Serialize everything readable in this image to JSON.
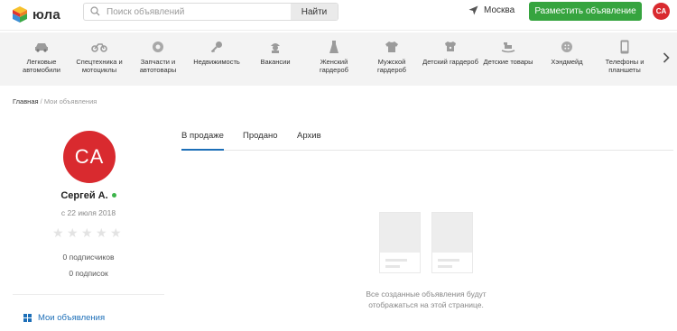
{
  "header": {
    "logo_text": "юла",
    "search_placeholder": "Поиск объявлений",
    "search_button": "Найти",
    "location": "Москва",
    "post_button": "Разместить объявление",
    "user_initials": "CA"
  },
  "categories": [
    {
      "label": "Легковые автомобили",
      "icon": "car-icon"
    },
    {
      "label": "Спецтехника и мотоциклы",
      "icon": "motorcycle-icon"
    },
    {
      "label": "Запчасти и автотовары",
      "icon": "wheel-icon"
    },
    {
      "label": "Недвижимость",
      "icon": "key-icon"
    },
    {
      "label": "Вакансии",
      "icon": "worker-icon"
    },
    {
      "label": "Женский гардероб",
      "icon": "dress-icon"
    },
    {
      "label": "Мужской гардероб",
      "icon": "shirt-icon"
    },
    {
      "label": "Детский гардероб",
      "icon": "kids-clothes-icon"
    },
    {
      "label": "Детские товары",
      "icon": "rocking-horse-icon"
    },
    {
      "label": "Хэндмейд",
      "icon": "button-icon"
    },
    {
      "label": "Телефоны и планшеты",
      "icon": "phone-icon"
    }
  ],
  "breadcrumb": {
    "home": "Главная",
    "separator": "/",
    "current": "Мои объявления"
  },
  "profile": {
    "initials": "CA",
    "name": "Сергей А.",
    "since": "с 22 июля 2018",
    "rating_stars": 0,
    "subscribers": "0 подписчиков",
    "subscriptions": "0 подписок",
    "my_ads_link": "Мои объявления"
  },
  "tabs": [
    {
      "label": "В продаже",
      "active": true
    },
    {
      "label": "Продано",
      "active": false
    },
    {
      "label": "Архив",
      "active": false
    }
  ],
  "empty_state": {
    "line1": "Все созданные объявления будут",
    "line2": "отображаться на этой странице."
  },
  "colors": {
    "brand_green": "#36a43f",
    "avatar_red": "#d92a2f",
    "link_blue": "#1d6fb8",
    "online_green": "#3cb44a"
  }
}
